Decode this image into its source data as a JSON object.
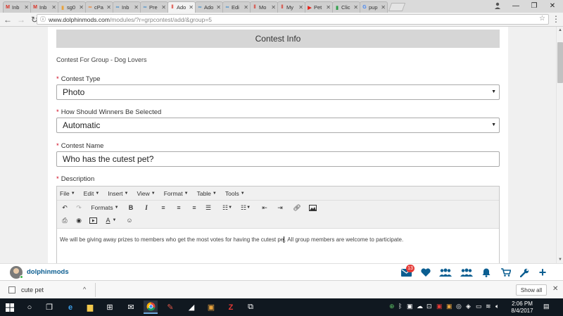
{
  "browser": {
    "tabs": [
      {
        "label": "Inb",
        "favicon": "M",
        "color": "#d93025",
        "active": false
      },
      {
        "label": "Inb",
        "favicon": "M",
        "color": "#d93025",
        "active": false
      },
      {
        "label": "sg0",
        "favicon": "▮",
        "color": "#e8a33d",
        "active": false
      },
      {
        "label": "cPa",
        "favicon": "∞",
        "color": "#f0802a",
        "active": false
      },
      {
        "label": "Inb",
        "favicon": "∞",
        "color": "#4a90c9",
        "active": false
      },
      {
        "label": "Pre",
        "favicon": "∞",
        "color": "#4a90c9",
        "active": false
      },
      {
        "label": "Ado",
        "favicon": "‖",
        "color": "#d93025",
        "active": true
      },
      {
        "label": "Ado",
        "favicon": "∞",
        "color": "#4a90c9",
        "active": false
      },
      {
        "label": "Edi",
        "favicon": "∞",
        "color": "#4a90c9",
        "active": false
      },
      {
        "label": "Mo",
        "favicon": "‖",
        "color": "#d93025",
        "active": false
      },
      {
        "label": "My",
        "favicon": "‖",
        "color": "#d93025",
        "active": false
      },
      {
        "label": "Pet",
        "favicon": "▶",
        "color": "#e62117",
        "active": false
      },
      {
        "label": "Clic",
        "favicon": "▮",
        "color": "#2e9f4a",
        "active": false
      },
      {
        "label": "pup",
        "favicon": "G",
        "color": "#4285f4",
        "active": false
      }
    ],
    "close_glyph": "✕",
    "url_domain": "www.dolphinmods.com",
    "url_path": "/modules/?r=grpcontest/add/&group=5"
  },
  "form": {
    "section_title": "Contest Info",
    "group_line": "Contest For Group - Dog Lovers",
    "required_mark": "*",
    "contest_type": {
      "label": "Contest Type",
      "value": "Photo"
    },
    "winner_selection": {
      "label": "How Should Winners Be Selected",
      "value": "Automatic"
    },
    "contest_name": {
      "label": "Contest Name",
      "value": "Who has the cutest pet?"
    },
    "description": {
      "label": "Description",
      "menus": [
        "File",
        "Edit",
        "Insert",
        "View",
        "Format",
        "Table",
        "Tools"
      ],
      "formats_label": "Formats",
      "text_before_cursor": "We will be giving away prizes to members who get the most votes for having the cutest pe",
      "text_after_cursor": ". All group members are welcome to participate."
    }
  },
  "appnav": {
    "username": "dolphinmods",
    "notification_count": "13",
    "accent": "#0b5e91"
  },
  "downloads": {
    "file_name": "cute pet",
    "show_all_label": "Show all"
  },
  "taskbar": {
    "time": "2:06 PM",
    "date": "8/4/2017"
  }
}
